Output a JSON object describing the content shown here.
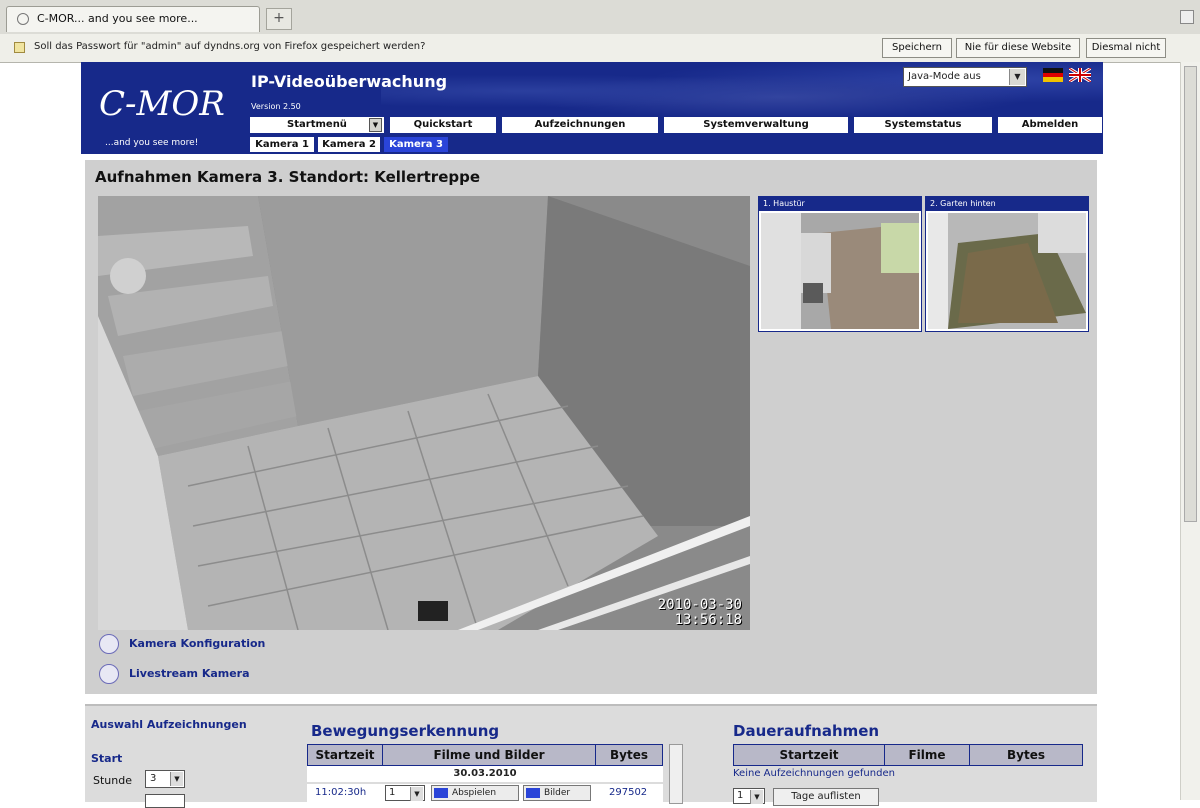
{
  "browser": {
    "tab_title": "C-MOR... and you see more...",
    "new_tab_symbol": "+",
    "notification_text": "Soll das Passwort für \"admin\" auf dyndns.org von Firefox gespeichert werden?",
    "buttons": {
      "save": "Speichern",
      "never": "Nie für diese Website",
      "close": "Diesmal nicht"
    }
  },
  "header": {
    "logo": "C-MOR",
    "tagline": "...and you see more!",
    "title": "IP-Videoüberwachung",
    "version": "Version 2.50",
    "java_mode": "Java-Mode aus",
    "languages": [
      "de",
      "en"
    ]
  },
  "nav": {
    "items": [
      "Startmenü",
      "Quickstart",
      "Aufzeichnungen",
      "Systemverwaltung",
      "Systemstatus",
      "Abmelden"
    ]
  },
  "camera_tabs": {
    "items": [
      "Kamera 1",
      "Kamera 2",
      "Kamera 3"
    ],
    "active_index": 2
  },
  "main": {
    "page_title": "Aufnahmen Kamera 3. Standort: Kellertreppe",
    "timestamp_date": "2010-03-30",
    "timestamp_time": "13:56:18",
    "thumbnails": [
      {
        "label": "1. Haustür"
      },
      {
        "label": "2. Garten hinten"
      }
    ],
    "links": {
      "config": "Kamera Konfiguration",
      "livestream": "Livestream Kamera"
    }
  },
  "selection": {
    "title": "Auswahl Aufzeichnungen",
    "start_label": "Start",
    "hour_label": "Stunde",
    "hour_value": "3"
  },
  "motion": {
    "title": "Bewegungserkennung",
    "columns": [
      "Startzeit",
      "Filme und Bilder",
      "Bytes"
    ],
    "date": "30.03.2010",
    "rows": [
      {
        "time": "11:02:30h",
        "select": "1",
        "play": "Abspielen",
        "images": "Bilder",
        "bytes": "297502"
      }
    ]
  },
  "continuous": {
    "title": "Daueraufnahmen",
    "columns": [
      "Startzeit",
      "Filme",
      "Bytes"
    ],
    "empty_text": "Keine Aufzeichnungen gefunden",
    "day_select": "1",
    "day_button": "Tage auflisten"
  },
  "colors": {
    "brand_blue": "#17298a",
    "active_tab": "#2a44d8",
    "panel_grey": "#cfcfcf"
  }
}
